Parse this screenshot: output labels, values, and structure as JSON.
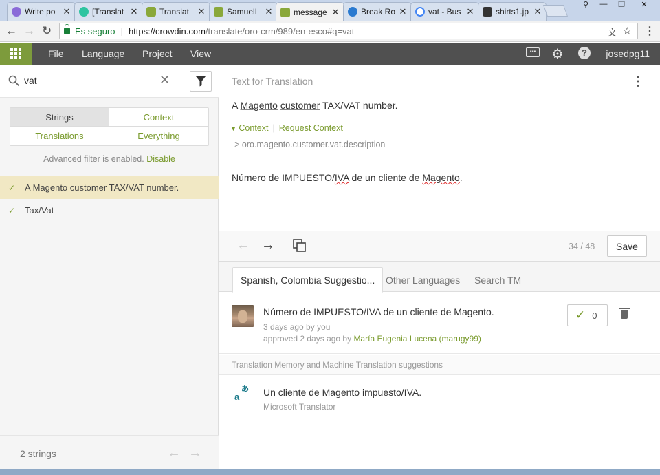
{
  "browser": {
    "tabs": [
      {
        "title": "Write po",
        "color": "#8a6bd8"
      },
      {
        "title": "[Translat",
        "color": "#2ec4a0"
      },
      {
        "title": "Translat",
        "color": "#8aa83a"
      },
      {
        "title": "SamuelL",
        "color": "#8aa83a"
      },
      {
        "title": "message",
        "color": "#8aa83a"
      },
      {
        "title": "Break Ro",
        "color": "#2a7ad0"
      },
      {
        "title": "vat - Bus",
        "color": "#4285f4"
      },
      {
        "title": "shirts1.jp",
        "color": "#333333"
      }
    ],
    "secure_label": "Es seguro",
    "url_domain": "https://crowdin.com",
    "url_path": "/translate/oro-crm/989/en-esco#q=vat"
  },
  "app_header": {
    "menu": [
      "File",
      "Language",
      "Project",
      "View"
    ],
    "username": "josedpg11"
  },
  "left": {
    "search_value": "vat",
    "segments": {
      "strings": "Strings",
      "context": "Context",
      "translations": "Translations",
      "everything": "Everything"
    },
    "adv_filter_text": "Advanced filter is enabled.",
    "adv_filter_link": "Disable",
    "strings_list": [
      {
        "text": "A Magento customer TAX/VAT number.",
        "selected": true
      },
      {
        "text": "Tax/Vat",
        "selected": false
      }
    ],
    "footer_count": "2 strings"
  },
  "source": {
    "header": "Text for Translation",
    "text_a": "A ",
    "text_magento": "Magento",
    "text_customer": "customer",
    "text_rest": " TAX/VAT number.",
    "context_link": "Context",
    "request_context": "Request Context",
    "key": "-> oro.magento.customer.vat.description"
  },
  "editor": {
    "text_1": "Número de IMPUESTO/",
    "text_iva": "IVA",
    "text_2": " de un cliente de ",
    "text_magento": "Magento",
    "text_3": "."
  },
  "toolbar": {
    "counter": "34 / 48",
    "save_label": "Save"
  },
  "suggestions": {
    "tabs": [
      "Spanish, Colombia Suggestio...",
      "Other Languages",
      "Search TM"
    ],
    "item": {
      "text": "Número de IMPUESTO/IVA de un cliente de Magento.",
      "meta1": "3 days ago by you",
      "meta2_prefix": "approved 2 days ago by ",
      "meta2_user": "María Eugenia Lucena (marugy99)",
      "votes": "0"
    },
    "tm_header": "Translation Memory and Machine Translation suggestions",
    "mt": {
      "text": "Un cliente de Magento impuesto/IVA.",
      "source": "Microsoft Translator"
    }
  },
  "colors": {
    "accent": "#7a9b2e",
    "header_bg": "#505050",
    "selected_row": "#f1e8c4"
  }
}
